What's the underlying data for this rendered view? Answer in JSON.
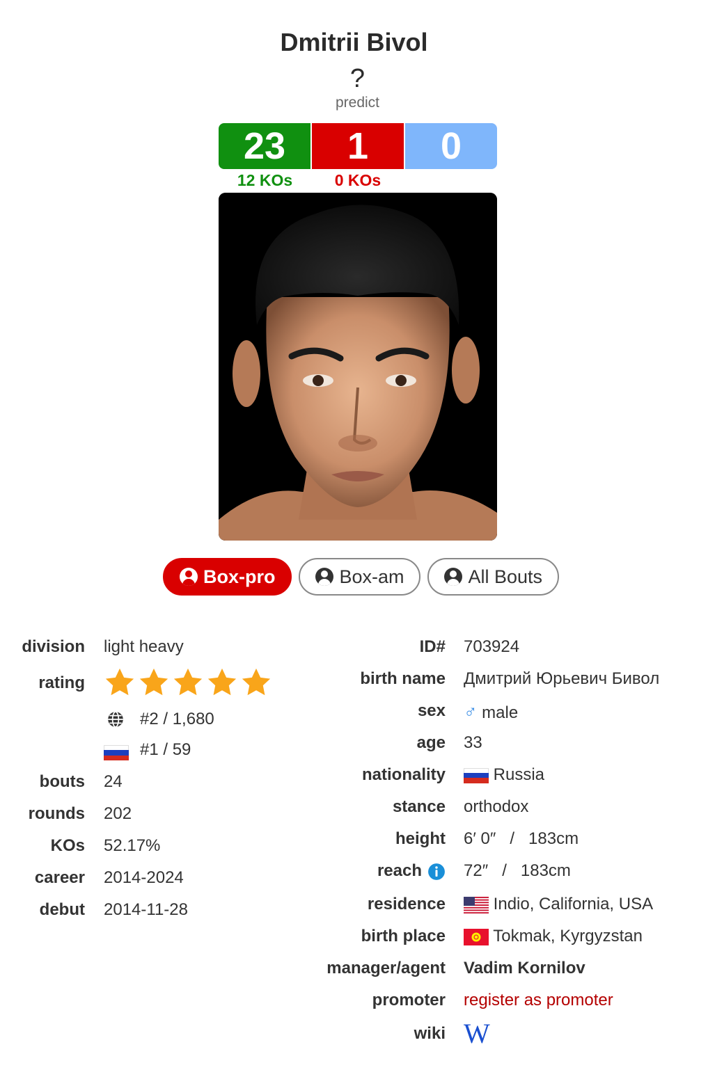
{
  "header": {
    "name": "Dmitrii Bivol",
    "predict_symbol": "?",
    "predict_label": "predict"
  },
  "record": {
    "wins": "23",
    "losses": "1",
    "draws": "0",
    "win_kos": "12 KOs",
    "loss_kos": "0 KOs"
  },
  "tabs": [
    {
      "label": "Box-pro",
      "active": true
    },
    {
      "label": "Box-am",
      "active": false
    },
    {
      "label": "All Bouts",
      "active": false
    }
  ],
  "left": {
    "division_label": "division",
    "division_value": "light heavy",
    "rating_label": "rating",
    "rating_stars": 5,
    "world_rank": "#2 / 1,680",
    "country_rank": "#1 / 59",
    "bouts_label": "bouts",
    "bouts_value": "24",
    "rounds_label": "rounds",
    "rounds_value": "202",
    "kos_label": "KOs",
    "kos_value": "52.17%",
    "career_label": "career",
    "career_value": "2014-2024",
    "debut_label": "debut",
    "debut_value": "2014-11-28"
  },
  "right": {
    "id_label": "ID#",
    "id_value": "703924",
    "birthname_label": "birth name",
    "birthname_value": "Дмитрий Юрьевич Бивол",
    "sex_label": "sex",
    "sex_symbol": "♂",
    "sex_value": "male",
    "age_label": "age",
    "age_value": "33",
    "nationality_label": "nationality",
    "nationality_value": "Russia",
    "stance_label": "stance",
    "stance_value": "orthodox",
    "height_label": "height",
    "height_value": "6′ 0″   /   183cm",
    "reach_label": "reach",
    "reach_value": "72″   /   183cm",
    "residence_label": "residence",
    "residence_value": "Indio, California, USA",
    "birthplace_label": "birth place",
    "birthplace_value": "Tokmak, Kyrgyzstan",
    "manager_label": "manager/agent",
    "manager_value": "Vadim Kornilov",
    "promoter_label": "promoter",
    "promoter_value": "register as promoter",
    "wiki_label": "wiki",
    "wiki_symbol": "W"
  },
  "colors": {
    "win": "#109010",
    "loss": "#d90000",
    "draw": "#7fb6fb",
    "star": "#f9a51a",
    "link": "#b40000",
    "info": "#1a8fd8"
  }
}
